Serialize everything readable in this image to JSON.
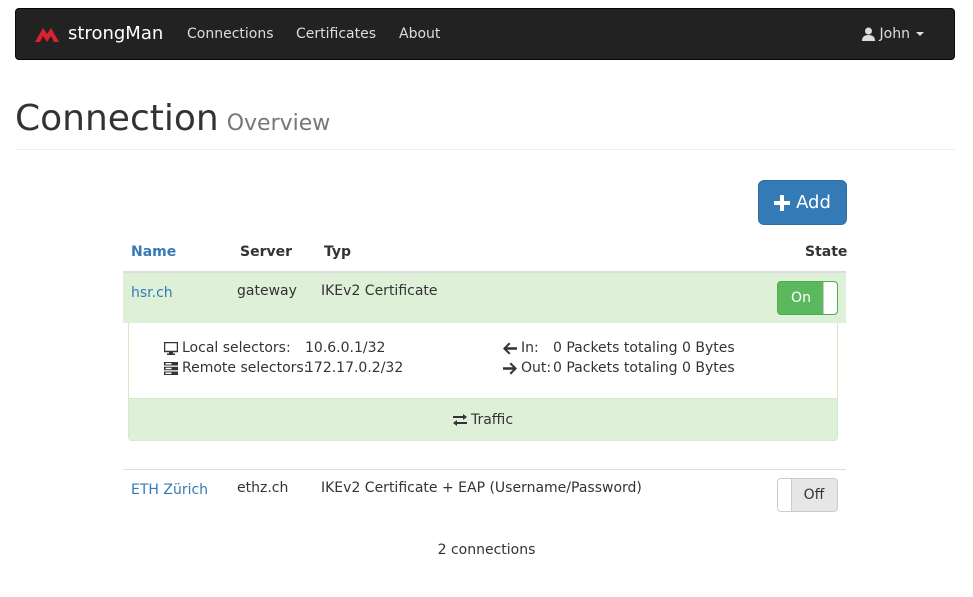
{
  "navbar": {
    "brand": "strongMan",
    "links": [
      "Connections",
      "Certificates",
      "About"
    ],
    "user": "John"
  },
  "page_header": {
    "title": "Connection",
    "subtitle": "Overview"
  },
  "add_button": {
    "label": "Add"
  },
  "table": {
    "headers": {
      "name": "Name",
      "server": "Server",
      "typ": "Typ",
      "state": "State"
    },
    "rows": [
      {
        "name": "hsr.ch",
        "server": "gateway",
        "typ": "IKEv2 Certificate",
        "state": "On"
      },
      {
        "name": "ETH Zürich",
        "server": "ethz.ch",
        "typ": "IKEv2 Certificate + EAP (Username/Password)",
        "state": "Off"
      }
    ]
  },
  "details": {
    "local_label": "Local selectors:",
    "local_value": "10.6.0.1/32",
    "remote_label": "Remote selectors:",
    "remote_value": "172.17.0.2/32",
    "in_label": "In:",
    "in_value": "0 Packets totaling 0 Bytes",
    "out_label": "Out:",
    "out_value": "0 Packets totaling 0 Bytes",
    "traffic_label": "Traffic"
  },
  "footer": {
    "count": "2 connections"
  },
  "colors": {
    "primary": "#337ab7",
    "success": "#5cb85c",
    "active_row": "#dff0d8",
    "navbar": "#222222"
  }
}
